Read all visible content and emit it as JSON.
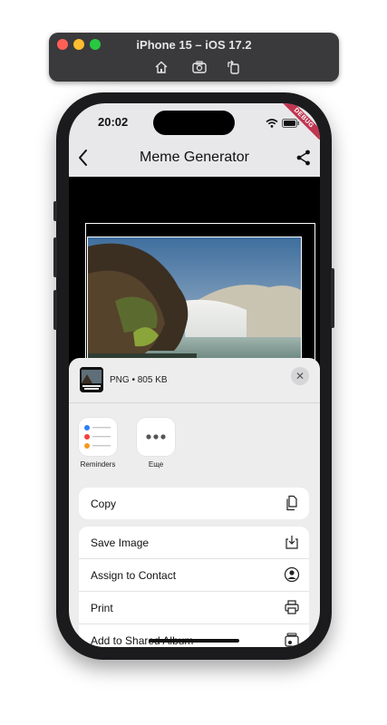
{
  "simulator": {
    "title": "iPhone 15 – iOS 17.2",
    "buttons": [
      "home-icon",
      "screenshot-icon",
      "rotate-icon"
    ]
  },
  "status_bar": {
    "time": "20:02",
    "debug_banner": "DEBUG"
  },
  "app_bar": {
    "title": "Meme Generator"
  },
  "share_sheet": {
    "file_info": "PNG • 805 KB",
    "apps": [
      {
        "label": "Reminders",
        "icon": "reminders-icon"
      },
      {
        "label": "Еще",
        "icon": "more-icon"
      }
    ],
    "actions_primary": [
      {
        "label": "Copy",
        "icon": "copy-icon"
      }
    ],
    "actions_secondary": [
      {
        "label": "Save Image",
        "icon": "save-image-icon"
      },
      {
        "label": "Assign to Contact",
        "icon": "contact-icon"
      },
      {
        "label": "Print",
        "icon": "printer-icon"
      },
      {
        "label": "Add to Shared Album",
        "icon": "shared-album-icon"
      }
    ]
  },
  "colors": {
    "sheet_background": "#ededee",
    "app_bar_background": "#e8e8ea",
    "debug_ribbon": "#c03550"
  }
}
